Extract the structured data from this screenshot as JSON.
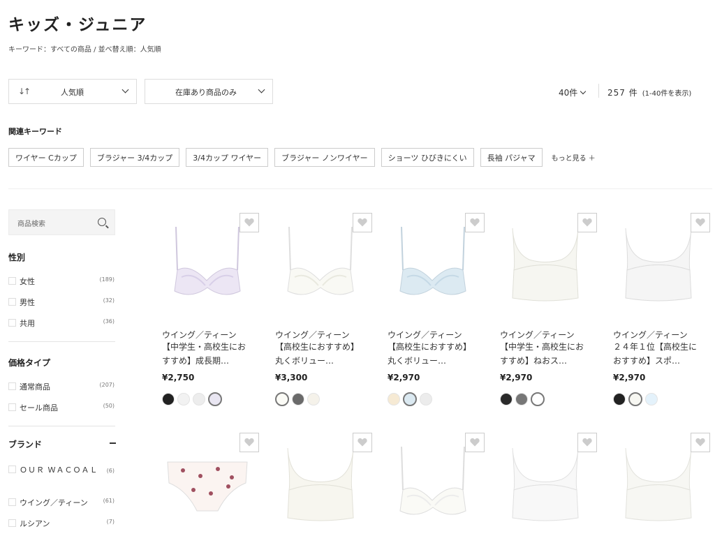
{
  "page": {
    "title": "キッズ・ジュニア",
    "breadcrumb": "キーワード：すべての商品 / 並べ替え順：人気順"
  },
  "controls": {
    "sort_label": "人気順",
    "stock_label": "在庫あり商品のみ",
    "per_page": "40件",
    "total": "257 件",
    "range": "(1-40件を表示)"
  },
  "related": {
    "title": "関連キーワード",
    "chips": [
      "ワイヤー Cカップ",
      "ブラジャー 3/4カップ",
      "3/4カップ ワイヤー",
      "ブラジャー ノンワイヤー",
      "ショーツ ひびきにくい",
      "長袖 パジャマ"
    ],
    "more": "もっと見る ＋"
  },
  "sidebar": {
    "search_placeholder": "商品検索",
    "gender": {
      "title": "性別",
      "items": [
        {
          "label": "女性",
          "count": "(189)"
        },
        {
          "label": "男性",
          "count": "(32)"
        },
        {
          "label": "共用",
          "count": "(36)"
        }
      ]
    },
    "price_type": {
      "title": "価格タイプ",
      "items": [
        {
          "label": "通常商品",
          "count": "(207)"
        },
        {
          "label": "セール商品",
          "count": "(50)"
        }
      ]
    },
    "brand": {
      "title": "ブランド",
      "items": [
        {
          "label": "ＯＵＲ ＷＡＣＯＡＬ",
          "count": "(6)"
        },
        {
          "label": "ウイング／ティーン",
          "count": "(61)"
        },
        {
          "label": "ルシアン",
          "count": "(7)"
        }
      ]
    }
  },
  "products": [
    {
      "brand": "ウイング／ティーン",
      "title": "【中学生・高校生におすすめ】成長期…",
      "price": "¥2,750",
      "swatches": [
        "#222222",
        "#f2f2f2",
        "#ededed",
        "#e9e6f2"
      ],
      "selected": 3
    },
    {
      "brand": "ウイング／ティーン",
      "title": "【高校生におすすめ】丸くボリュー…",
      "price": "¥3,300",
      "swatches": [
        "#fbfbf6",
        "#6a6a6a",
        "#f5f2ea"
      ],
      "selected": 0
    },
    {
      "brand": "ウイング／ティーン",
      "title": "【高校生におすすめ】丸くボリュー…",
      "price": "¥2,970",
      "swatches": [
        "#f6ead4",
        "#dbe9f1",
        "#ececec"
      ],
      "selected": 1
    },
    {
      "brand": "ウイング／ティーン",
      "title": "【中学生・高校生におすすめ】ねおス…",
      "price": "¥2,970",
      "swatches": [
        "#2a2a2a",
        "#777777",
        "#ffffff"
      ],
      "selected": 2
    },
    {
      "brand": "ウイング／ティーン",
      "title": "２４年１位【高校生におすすめ】スポ…",
      "price": "¥2,970",
      "swatches": [
        "#222222",
        "#f7f7f2",
        "#e4f2fb"
      ],
      "selected": 1
    },
    {},
    {},
    {},
    {},
    {}
  ],
  "icons": {
    "sort": "sort-icon",
    "chevron": "chevron-down-icon",
    "search": "search-icon",
    "heart": "heart-icon"
  }
}
